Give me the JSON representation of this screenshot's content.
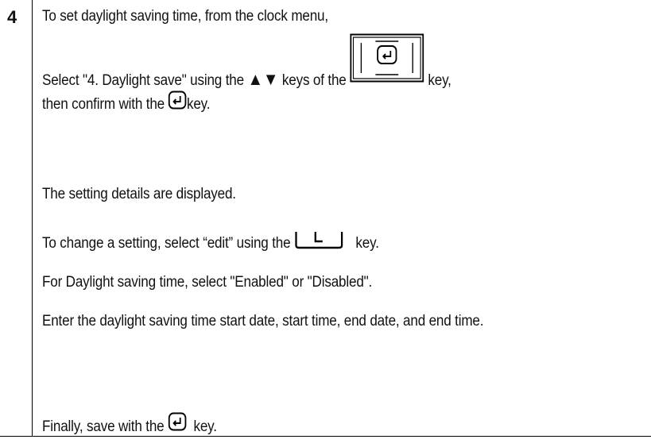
{
  "step": {
    "number": "4"
  },
  "lines": {
    "l1": "To set daylight saving time, from the clock menu,",
    "l2_a": "Select \"4. Daylight save\" using the ",
    "l2_up": "▲",
    "l2_down": "▼",
    "l2_b": " keys of the ",
    "l2_c": " key,",
    "l3_a": "then confirm with the ",
    "l3_b": "key.",
    "l4": "The setting details are displayed.",
    "l5_a": "To change a setting, select “edit” using the ",
    "l5_key": "L",
    "l5_b": "key.",
    "l6": "For Daylight saving time, select \"Enabled\" or \"Disabled\".",
    "l7": "Enter the daylight saving time start date, start time, end date, and end time.",
    "l8_a": "Finally, save with the ",
    "l8_b": "key."
  },
  "icons": {
    "navigation_key": "navigation-pad-with-enter-key-icon",
    "enter_key": "enter-key-icon",
    "softkey": "left-softkey-icon"
  }
}
